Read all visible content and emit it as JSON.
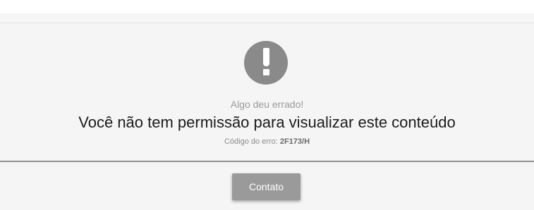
{
  "error": {
    "icon": "exclamation-circle-icon",
    "subtitle": "Algo deu errado!",
    "message": "Você não tem permissão para visualizar este conteúdo",
    "code_label": "Código do erro:",
    "code_value": "2F173/H"
  },
  "actions": {
    "contact_label": "Contato"
  },
  "colors": {
    "background": "#f5f5f5",
    "icon": "#8a8a8a",
    "button": "#9a9a9a",
    "divider": "#8e8e8e"
  }
}
